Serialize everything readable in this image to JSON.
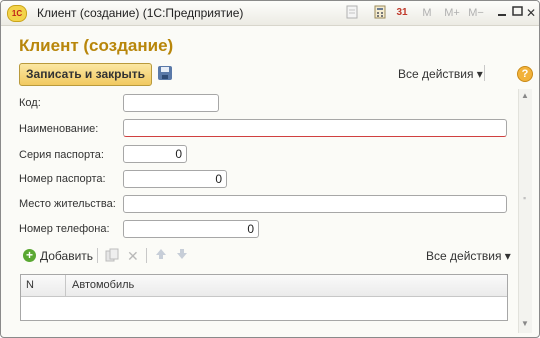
{
  "window": {
    "title": "Клиент (создание)  (1С:Предприятие)",
    "logo_text": "1С",
    "toolbar_icons": [
      "document-icon",
      "calculator-icon",
      "calendar-icon",
      "memory-m-icon",
      "memory-plus-icon",
      "memory-minus-icon",
      "minimize-icon",
      "maximize-icon",
      "close-icon"
    ],
    "labels": {
      "calendar": "31",
      "m": "M",
      "m_plus": "M+",
      "m_minus": "M−",
      "close": "✕"
    }
  },
  "form": {
    "title": "Клиент (создание)",
    "save_close_label": "Записать и закрыть",
    "all_actions_label": "Все действия ▾",
    "help_label": "?"
  },
  "fields": {
    "code": {
      "label": "Код:",
      "value": ""
    },
    "name": {
      "label": "Наименование:",
      "value": ""
    },
    "passport_series": {
      "label": "Серия паспорта:",
      "value": "0"
    },
    "passport_number": {
      "label": "Номер паспорта:",
      "value": "0"
    },
    "residence": {
      "label": "Место жительства:",
      "value": ""
    },
    "phone": {
      "label": "Номер телефона:",
      "value": "0"
    }
  },
  "table": {
    "add_label": "Добавить",
    "all_actions_label": "Все действия ▾",
    "columns": [
      "N",
      "Автомобиль"
    ],
    "rows": []
  },
  "colors": {
    "title": "#b8860b",
    "primary_button": "#f1c960",
    "required_underline": "#d04040"
  }
}
